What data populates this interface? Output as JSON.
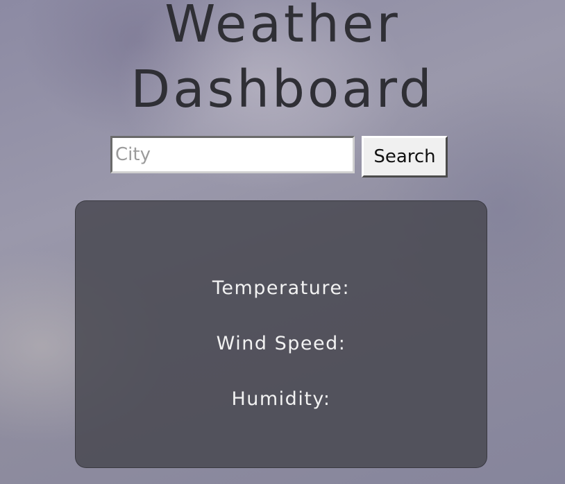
{
  "header": {
    "title_line1": "Weather",
    "title_line2": "Dashboard"
  },
  "search": {
    "placeholder": "City",
    "value": "",
    "button_label": "Search"
  },
  "weather_card": {
    "temperature_label": "Temperature:",
    "wind_speed_label": "Wind Speed:",
    "humidity_label": "Humidity:"
  }
}
